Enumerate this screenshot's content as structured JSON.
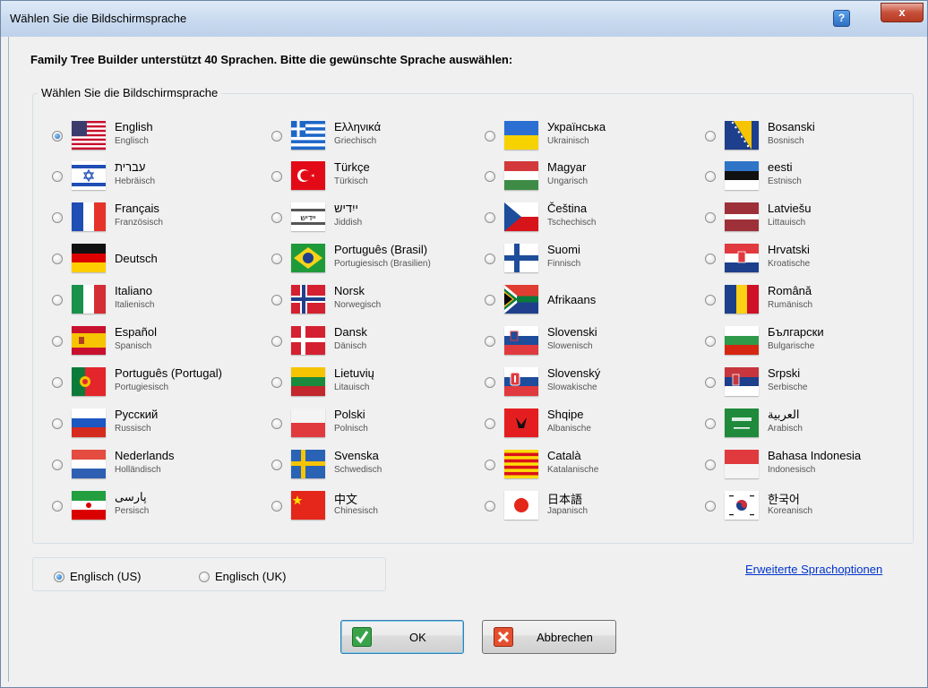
{
  "window": {
    "title": "Wählen Sie die Bildschirmsprache",
    "help_label": "?",
    "close_label": "x"
  },
  "heading": "Family Tree Builder unterstützt 40 Sprachen. Bitte die gewünschte Sprache auswählen:",
  "group_label": "Wählen Sie die Bildschirmsprache",
  "languages": [
    {
      "name": "English",
      "sub": "Englisch",
      "flag": "us-flag-icon",
      "checked": true
    },
    {
      "name": "עברית",
      "sub": "Hebräisch",
      "flag": "israel-flag-icon"
    },
    {
      "name": "Français",
      "sub": "Französisch",
      "flag": "france-flag-icon"
    },
    {
      "name": "Deutsch",
      "sub": "",
      "flag": "germany-flag-icon"
    },
    {
      "name": "Italiano",
      "sub": "Italienisch",
      "flag": "italy-flag-icon"
    },
    {
      "name": "Español",
      "sub": "Spanisch",
      "flag": "spain-flag-icon"
    },
    {
      "name": "Português (Portugal)",
      "sub": "Portugiesisch",
      "flag": "portugal-flag-icon"
    },
    {
      "name": "Русский",
      "sub": "Russisch",
      "flag": "russia-flag-icon"
    },
    {
      "name": "Nederlands",
      "sub": "Holländisch",
      "flag": "netherlands-flag-icon"
    },
    {
      "name": "پارسی",
      "sub": "Persisch",
      "flag": "iran-flag-icon"
    },
    {
      "name": "Ελληνικά",
      "sub": "Griechisch",
      "flag": "greece-flag-icon"
    },
    {
      "name": "Türkçe",
      "sub": "Türkisch",
      "flag": "turkey-flag-icon"
    },
    {
      "name": "ייִדיש",
      "sub": "Jiddish",
      "flag": "yiddish-flag-icon"
    },
    {
      "name": "Português (Brasil)",
      "sub": "Portugiesisch (Brasilien)",
      "flag": "brazil-flag-icon"
    },
    {
      "name": "Norsk",
      "sub": "Norwegisch",
      "flag": "norway-flag-icon"
    },
    {
      "name": "Dansk",
      "sub": "Dänisch",
      "flag": "denmark-flag-icon"
    },
    {
      "name": "Lietuvių",
      "sub": "Litauisch",
      "flag": "lithuania-flag-icon"
    },
    {
      "name": "Polski",
      "sub": "Polnisch",
      "flag": "poland-flag-icon"
    },
    {
      "name": "Svenska",
      "sub": "Schwedisch",
      "flag": "sweden-flag-icon"
    },
    {
      "name": "中文",
      "sub": "Chinesisch",
      "flag": "china-flag-icon"
    },
    {
      "name": "Українська",
      "sub": "Ukrainisch",
      "flag": "ukraine-flag-icon"
    },
    {
      "name": "Magyar",
      "sub": "Ungarisch",
      "flag": "hungary-flag-icon"
    },
    {
      "name": "Čeština",
      "sub": "Tschechisch",
      "flag": "czech-flag-icon"
    },
    {
      "name": "Suomi",
      "sub": "Finnisch",
      "flag": "finland-flag-icon"
    },
    {
      "name": "Afrikaans",
      "sub": "",
      "flag": "south-africa-flag-icon"
    },
    {
      "name": "Slovenski",
      "sub": "Slowenisch",
      "flag": "slovenia-flag-icon"
    },
    {
      "name": "Slovenský",
      "sub": "Slowakische",
      "flag": "slovakia-flag-icon"
    },
    {
      "name": "Shqipe",
      "sub": "Albanische",
      "flag": "albania-flag-icon"
    },
    {
      "name": "Català",
      "sub": "Katalanische",
      "flag": "catalonia-flag-icon"
    },
    {
      "name": "日本語",
      "sub": "Japanisch",
      "flag": "japan-flag-icon"
    },
    {
      "name": "Bosanski",
      "sub": "Bosnisch",
      "flag": "bosnia-flag-icon"
    },
    {
      "name": "eesti",
      "sub": "Estnisch",
      "flag": "estonia-flag-icon"
    },
    {
      "name": "Latviešu",
      "sub": "Littauisch",
      "flag": "latvia-flag-icon"
    },
    {
      "name": "Hrvatski",
      "sub": "Kroatische",
      "flag": "croatia-flag-icon"
    },
    {
      "name": "Română",
      "sub": "Rumänisch",
      "flag": "romania-flag-icon"
    },
    {
      "name": "Български",
      "sub": "Bulgarische",
      "flag": "bulgaria-flag-icon"
    },
    {
      "name": "Srpski",
      "sub": "Serbische",
      "flag": "serbia-flag-icon"
    },
    {
      "name": "العربية",
      "sub": "Arabisch",
      "flag": "saudi-arabia-flag-icon"
    },
    {
      "name": "Bahasa Indonesia",
      "sub": "Indonesisch",
      "flag": "indonesia-flag-icon"
    },
    {
      "name": "한국어",
      "sub": "Koreanisch",
      "flag": "korea-flag-icon"
    }
  ],
  "variants": {
    "us_label": "Englisch (US)",
    "uk_label": "Englisch (UK)",
    "selected": "us"
  },
  "advanced_link": "Erweiterte Sprachoptionen",
  "buttons": {
    "ok_label": "OK",
    "cancel_label": "Abbrechen"
  }
}
